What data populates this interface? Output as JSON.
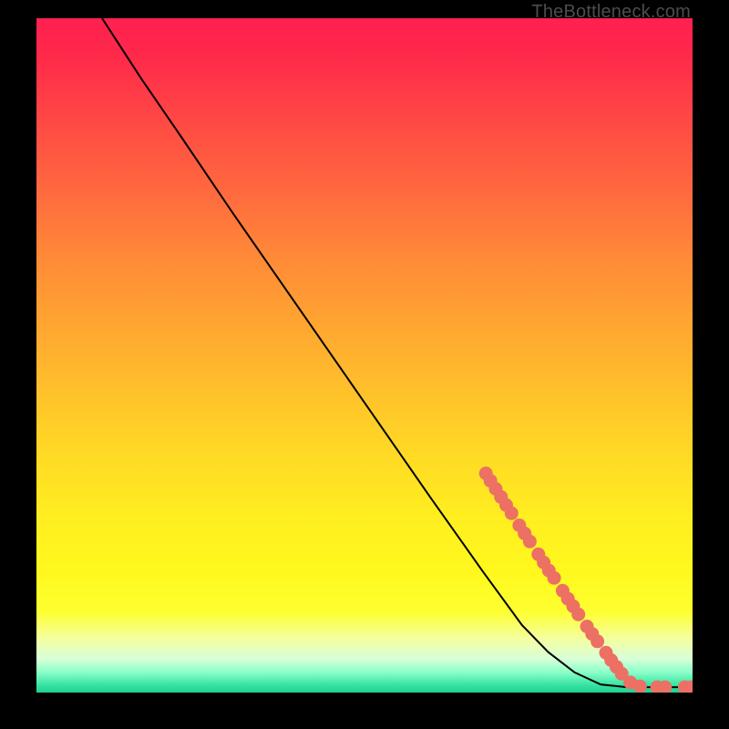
{
  "watermark": "TheBottleneck.com",
  "chart_data": {
    "type": "line",
    "title": "",
    "xlabel": "",
    "ylabel": "",
    "xlim": [
      0,
      100
    ],
    "ylim": [
      0,
      100
    ],
    "curve": [
      {
        "x": 10,
        "y": 100
      },
      {
        "x": 12,
        "y": 97
      },
      {
        "x": 16,
        "y": 91
      },
      {
        "x": 22,
        "y": 82.5
      },
      {
        "x": 30,
        "y": 71
      },
      {
        "x": 40,
        "y": 57
      },
      {
        "x": 50,
        "y": 43
      },
      {
        "x": 60,
        "y": 29
      },
      {
        "x": 68,
        "y": 18
      },
      {
        "x": 74,
        "y": 10
      },
      {
        "x": 78,
        "y": 6
      },
      {
        "x": 82,
        "y": 3
      },
      {
        "x": 86,
        "y": 1.2
      },
      {
        "x": 90,
        "y": 0.8
      },
      {
        "x": 95,
        "y": 0.8
      },
      {
        "x": 100,
        "y": 0.8
      }
    ],
    "markers": [
      {
        "x": 68.5,
        "y": 32.5
      },
      {
        "x": 69.2,
        "y": 31.4
      },
      {
        "x": 70.0,
        "y": 30.2
      },
      {
        "x": 70.8,
        "y": 29.0
      },
      {
        "x": 71.6,
        "y": 27.8
      },
      {
        "x": 72.4,
        "y": 26.6
      },
      {
        "x": 73.6,
        "y": 24.8
      },
      {
        "x": 74.4,
        "y": 23.6
      },
      {
        "x": 75.2,
        "y": 22.4
      },
      {
        "x": 76.5,
        "y": 20.5
      },
      {
        "x": 77.3,
        "y": 19.3
      },
      {
        "x": 78.1,
        "y": 18.1
      },
      {
        "x": 78.9,
        "y": 17.0
      },
      {
        "x": 80.2,
        "y": 15.1
      },
      {
        "x": 81.0,
        "y": 13.9
      },
      {
        "x": 81.8,
        "y": 12.8
      },
      {
        "x": 82.6,
        "y": 11.6
      },
      {
        "x": 83.9,
        "y": 9.8
      },
      {
        "x": 84.7,
        "y": 8.7
      },
      {
        "x": 85.5,
        "y": 7.6
      },
      {
        "x": 86.8,
        "y": 5.9
      },
      {
        "x": 87.6,
        "y": 4.8
      },
      {
        "x": 88.4,
        "y": 3.8
      },
      {
        "x": 89.2,
        "y": 2.8
      },
      {
        "x": 90.5,
        "y": 1.5
      },
      {
        "x": 92.0,
        "y": 0.9
      },
      {
        "x": 94.6,
        "y": 0.8
      },
      {
        "x": 95.8,
        "y": 0.8
      },
      {
        "x": 98.8,
        "y": 0.8
      },
      {
        "x": 99.8,
        "y": 0.8
      }
    ],
    "marker_color": "#ec7063",
    "curve_color": "#000000"
  }
}
